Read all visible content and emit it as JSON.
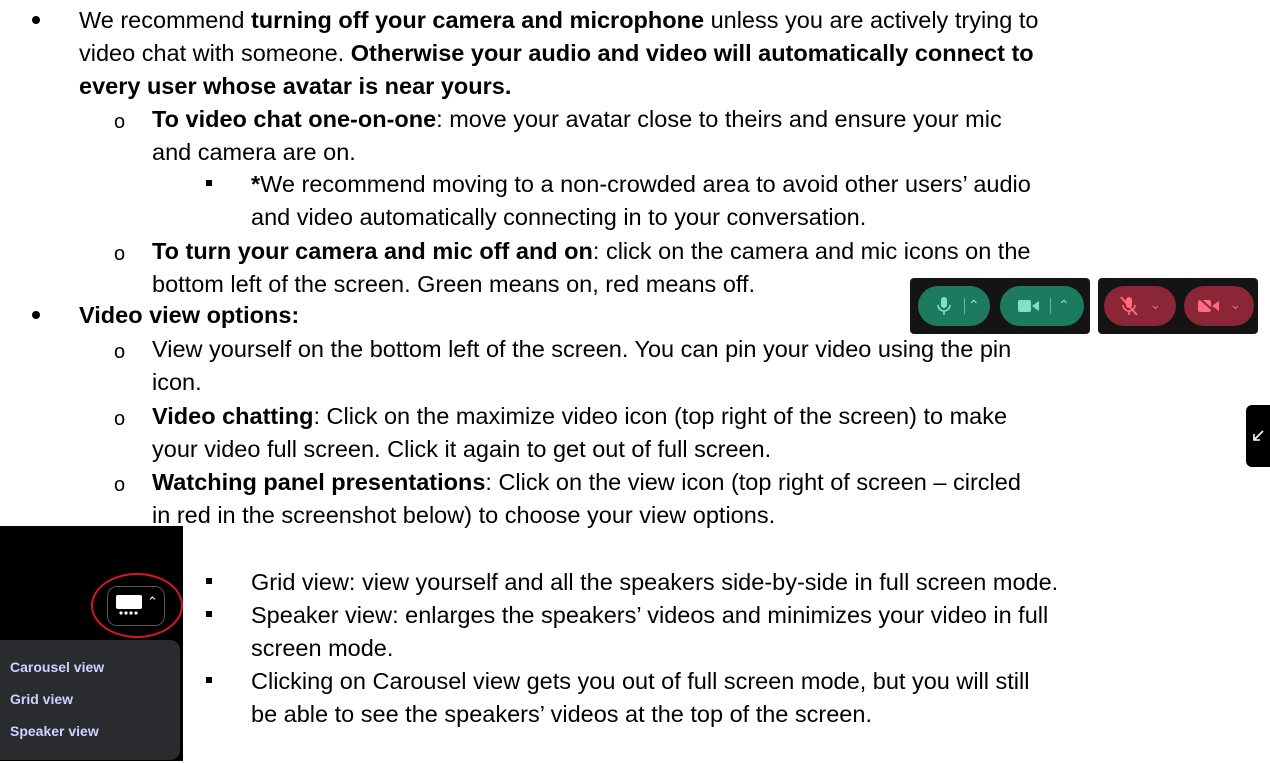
{
  "para1": {
    "l1_a": "We recommend ",
    "l1_b": "turning off your camera and microphone",
    "l1_c": " unless you are actively trying to",
    "l2_a": "video chat with someone. ",
    "l2_b": "Otherwise your audio and video will automatically connect to",
    "l3": "every user whose avatar is near yours."
  },
  "sub1": {
    "l1_b": "To video chat one-on-one",
    "l1_c": ": move your avatar close to theirs and ensure your mic",
    "l2": "and camera are on."
  },
  "subsub1": {
    "l1_b": "*",
    "l1_c": "We recommend moving to a non-crowded area to avoid other users’ audio",
    "l2": "and video automatically connecting in to your conversation."
  },
  "sub2": {
    "l1_b": "To turn your camera and mic off and on",
    "l1_c": ": click on the camera and mic icons on the",
    "l2": "bottom left of the screen. Green means on, red means off."
  },
  "para2": {
    "heading": "Video view options:"
  },
  "sub3": {
    "l1": "View yourself on the bottom left of the screen. You can pin your video using the pin",
    "l2": "icon."
  },
  "sub4": {
    "l1_b": "Video chatting",
    "l1_c": ": Click on the maximize video icon (top right of the screen) to make",
    "l2": "your video full screen. Click it again to get out of full screen."
  },
  "sub5": {
    "l1_b": "Watching panel presentations",
    "l1_c": ": Click on the view icon (top right of screen – circled",
    "l2": "in red in the screenshot below) to choose your view options."
  },
  "views": {
    "l1": "Grid view: view yourself and all the speakers side-by-side in full screen mode.",
    "l2a": "Speaker view: enlarges the speakers’ videos and minimizes your video in full",
    "l2b": "screen mode.",
    "l3a": "Clicking on Carousel view gets you out of full screen mode, but you will still",
    "l3b": "be able to see the speakers’ videos at the top of the screen."
  },
  "view_menu": {
    "items": [
      "Carousel view",
      "Grid view",
      "Speaker view"
    ]
  },
  "colors": {
    "on": "#1e7a5e",
    "off": "#8a2636",
    "circle": "#d8181c",
    "menu_text": "#cfd3ff"
  }
}
